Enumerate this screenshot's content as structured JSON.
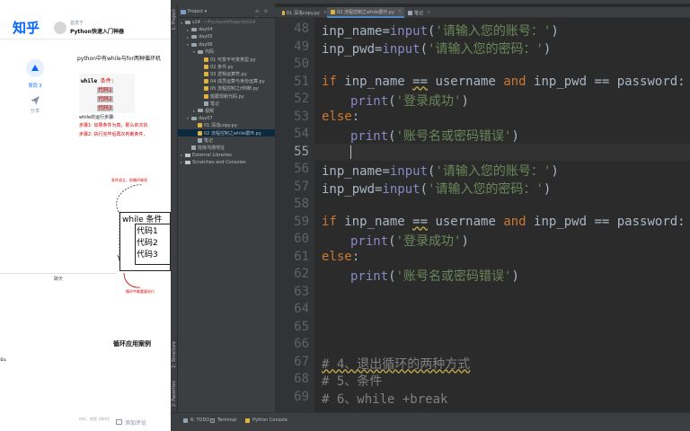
{
  "zhihu": {
    "logo": "知乎",
    "author": "首发于",
    "column_title": "Python快速入门神器",
    "vote_label": "赞同 3",
    "share_label": "分享",
    "intro": "python中有while与for两种循环机",
    "code_sample": {
      "keyword": "while",
      "condition": "条件:",
      "lines": [
        "代码1",
        "代码2",
        "代码3"
      ]
    },
    "steps_title": "while的运行步骤:",
    "step1": "步骤1: 如果条件为真，那么依次执",
    "step2": "步骤2: 执行完毕后再次判断条件，",
    "diagram": {
      "note_top": "条件成立，則循环继续",
      "note_bottom": "循环中被重复执行",
      "header": "while  条件",
      "lines": [
        "代码1",
        "代码2",
        "代码3"
      ]
    },
    "section_heading": "循环应用案例",
    "chat_title": "聊天",
    "chat_text": "ฉัน",
    "footer_left": "你好，就是【知乎】",
    "add_comment": "添加评论"
  },
  "ide": {
    "project_header": "Project",
    "tree": [
      {
        "label": "s14",
        "suffix": "~/PycharmProjects/s14",
        "level": 0,
        "type": "folder",
        "open": true
      },
      {
        "label": "day04",
        "level": 1,
        "type": "folder",
        "open": false
      },
      {
        "label": "day05",
        "level": 1,
        "type": "folder",
        "open": false
      },
      {
        "label": "day06",
        "level": 1,
        "type": "folder",
        "open": true
      },
      {
        "label": "代码",
        "level": 2,
        "type": "folder",
        "open": true
      },
      {
        "label": "01 可变不可变类型.py",
        "level": 3,
        "type": "py"
      },
      {
        "label": "02 条件.py",
        "level": 3,
        "type": "py"
      },
      {
        "label": "03 逻辑运算符.py",
        "level": 3,
        "type": "py"
      },
      {
        "label": "04 成员运算与身份运算.py",
        "level": 3,
        "type": "py"
      },
      {
        "label": "05 流程控制之if判断.py",
        "level": 3,
        "type": "py"
      },
      {
        "label": "题跟现新代码.py",
        "level": 3,
        "type": "py"
      },
      {
        "label": "笔记",
        "level": 3,
        "type": "md"
      },
      {
        "label": "视频",
        "level": 2,
        "type": "folder",
        "open": false
      },
      {
        "label": "day07",
        "level": 1,
        "type": "folder",
        "open": true
      },
      {
        "label": "01 深浅copy.py",
        "level": 2,
        "type": "py"
      },
      {
        "label": "02 流程控制之while循环.py",
        "level": 2,
        "type": "py",
        "selected": true
      },
      {
        "label": "笔记",
        "level": 2,
        "type": "md"
      },
      {
        "label": "班级沟通地址",
        "level": 1,
        "type": "md"
      },
      {
        "label": "External Libraries",
        "level": 0,
        "type": "lib",
        "open": false
      },
      {
        "label": "Scratches and Consoles",
        "level": 0,
        "type": "lib",
        "open": false
      }
    ],
    "tabs": [
      {
        "label": "01 深浅copy.py",
        "active": false
      },
      {
        "label": "02 流程控制之while循环.py",
        "active": true
      },
      {
        "label": "笔记",
        "active": false
      }
    ],
    "line_numbers": [
      "48",
      "49",
      "50",
      "51",
      "52",
      "53",
      "54",
      "55",
      "56",
      "57",
      "58",
      "59",
      "60",
      "61",
      "62",
      "63",
      "64",
      "65",
      "66",
      "67",
      "68",
      "69"
    ],
    "current_line": "55",
    "code": {
      "l48": {
        "a": "inp_name",
        "b": "=",
        "c": "input",
        "d": "(",
        "e": "'请输入您的账号：'",
        "f": ")"
      },
      "l49": {
        "a": "inp_pwd",
        "b": "=",
        "c": "input",
        "d": "(",
        "e": "'请输入您的密码：'",
        "f": ")"
      },
      "l51": {
        "kw_if": "if",
        "a": " inp_name ",
        "b": "==",
        "c": " username ",
        "kw_and": "and",
        "d": " inp_pwd == password:"
      },
      "l52": {
        "fn": "print",
        "p1": "(",
        "s": "'登录成功'",
        "p2": ")"
      },
      "l53": {
        "kw": "else",
        "colon": ":"
      },
      "l54": {
        "fn": "print",
        "p1": "(",
        "s": "'账号名或密码错误'",
        "p2": ")"
      },
      "l56": {
        "a": "inp_name",
        "b": "=",
        "c": "input",
        "d": "(",
        "e": "'请输入您的账号：'",
        "f": ")"
      },
      "l57": {
        "a": "inp_pwd",
        "b": "=",
        "c": "input",
        "d": "(",
        "e": "'请输入您的密码：'",
        "f": ")"
      },
      "l59": {
        "kw_if": "if",
        "a": " inp_name ",
        "b": "==",
        "c": " username ",
        "kw_and": "and",
        "d": " inp_pwd == password:"
      },
      "l60": {
        "fn": "print",
        "p1": "(",
        "s": "'登录成功'",
        "p2": ")"
      },
      "l61": {
        "kw": "else",
        "colon": ":"
      },
      "l62": {
        "fn": "print",
        "p1": "(",
        "s": "'账号名或密码错误'",
        "p2": ")"
      },
      "l67": "# 4、退出循环的两种方式",
      "l68": "# 5、条件",
      "l69": "# 6、while +break"
    },
    "left_strip": [
      "1: Project",
      "2: Structure",
      "2: Favorites"
    ],
    "bottom": [
      {
        "label": "6: TODO",
        "icon": "todo-icon"
      },
      {
        "label": "Terminal",
        "icon": "terminal-icon"
      },
      {
        "label": "Python Console",
        "icon": "python-console-icon"
      }
    ]
  }
}
